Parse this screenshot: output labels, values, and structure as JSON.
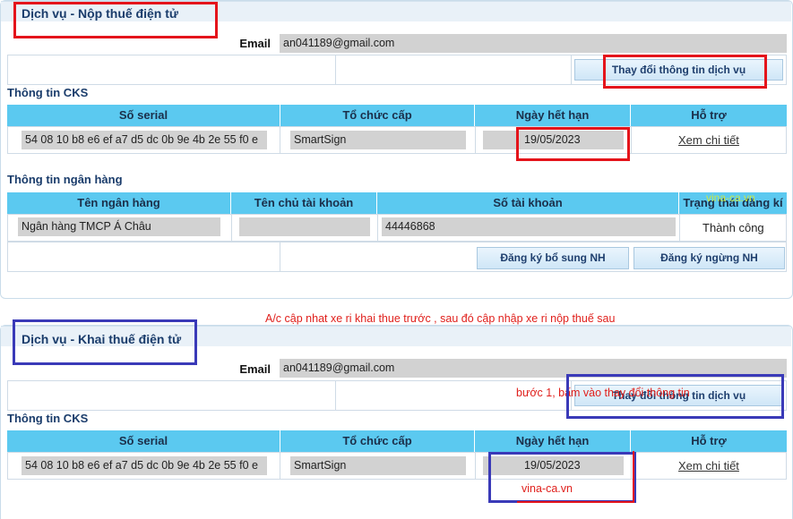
{
  "section1": {
    "title": "Dịch vụ - Nộp thuế điện tử",
    "email_label": "Email",
    "email_value": "an041189@gmail.com",
    "change_button": "Thay đổi thông tin dịch vụ",
    "cks": {
      "title": "Thông tin CKS",
      "headers": [
        "Số serial",
        "Tổ chức cấp",
        "Ngày hết hạn",
        "Hỗ trợ"
      ],
      "serial": "54 08 10 b8 e6 ef a7 d5 dc 0b 9e 4b 2e 55 f0 e",
      "issuer": "SmartSign",
      "expiry": "19/05/2023",
      "support_link": "Xem chi tiết"
    },
    "bank": {
      "title": "Thông tin ngân hàng",
      "headers": [
        "Tên ngân hàng",
        "Tên chủ tài khoản",
        "Số tài khoản",
        "Trạng thái đăng kí"
      ],
      "bank_name": "Ngân hàng TMCP Á Châu",
      "account_holder": "",
      "account_number": "44446868",
      "status": "Thành công",
      "add_button": "Đăng ký bổ sung NH",
      "stop_button": "Đăng ký ngừng NH"
    }
  },
  "annotation_main": "A/c cập nhat xe ri khai thue trước , sau đó cập nhập xe ri nộp thuế sau",
  "section2": {
    "title": "Dịch vụ - Khai thuế điện tử",
    "email_label": "Email",
    "email_value": "an041189@gmail.com",
    "change_button": "Thay đổi thông tin dịch vụ",
    "step_note": "bước 1, bấm vào thay đổi thông tin",
    "cks": {
      "title": "Thông tin CKS",
      "headers": [
        "Số serial",
        "Tổ chức cấp",
        "Ngày hết hạn",
        "Hỗ trợ"
      ],
      "serial": "54 08 10 b8 e6 ef a7 d5 dc 0b 9e 4b 2e 55 f0 e",
      "issuer": "SmartSign",
      "expiry": "19/05/2023",
      "support_link": "Xem chi tiết"
    }
  },
  "watermarks": {
    "top": "vina-ca.vn",
    "bottom": "vina-ca.vn"
  },
  "colors": {
    "header_bg": "#5bc9f0",
    "title_text": "#1a3c6b",
    "annotation_red": "#e4141b",
    "annotation_blue": "#3a3ab8"
  }
}
